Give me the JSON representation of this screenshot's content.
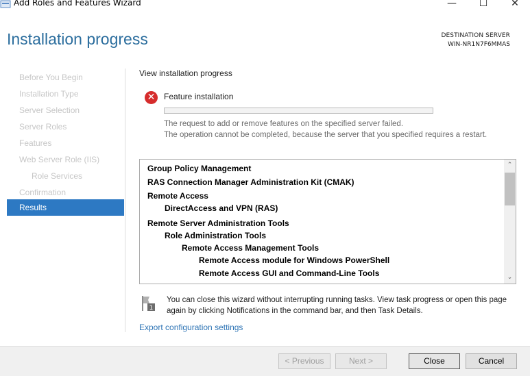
{
  "window": {
    "title": "Add Roles and Features Wizard",
    "minimize": "—",
    "maximize": "☐",
    "close": "✕"
  },
  "header": {
    "page_title": "Installation progress",
    "destination_label": "DESTINATION SERVER",
    "destination_server": "WIN-NR1N7F6MMAS"
  },
  "nav": {
    "items": [
      {
        "label": "Before You Begin"
      },
      {
        "label": "Installation Type"
      },
      {
        "label": "Server Selection"
      },
      {
        "label": "Server Roles"
      },
      {
        "label": "Features"
      },
      {
        "label": "Web Server Role (IIS)"
      },
      {
        "label": "Role Services"
      },
      {
        "label": "Confirmation"
      },
      {
        "label": "Results"
      }
    ],
    "active": "Results"
  },
  "content": {
    "section_label": "View installation progress",
    "status_title": "Feature installation",
    "progress_fraction": 0,
    "error_line1": "The request to add or remove features on the specified server failed.",
    "error_line2": "The operation cannot be completed, because the server that you specified requires a restart.",
    "results": [
      {
        "text": "Group Policy Management",
        "level": 0
      },
      {
        "text": "RAS Connection Manager Administration Kit (CMAK)",
        "level": 0
      },
      {
        "text": "Remote Access",
        "level": 0
      },
      {
        "text": "DirectAccess and VPN (RAS)",
        "level": 1
      },
      {
        "text": "Remote Server Administration Tools",
        "level": 0
      },
      {
        "text": "Role Administration Tools",
        "level": 1
      },
      {
        "text": "Remote Access Management Tools",
        "level": 2
      },
      {
        "text": "Remote Access module for Windows PowerShell",
        "level": 3
      },
      {
        "text": "Remote Access GUI and Command-Line Tools",
        "level": 3
      }
    ],
    "scroll_up": "⌃",
    "scroll_down": "⌄",
    "notice": "You can close this wizard without interrupting running tasks. View task progress or open this page again by clicking Notifications in the command bar, and then Task Details.",
    "flag_badge": "1",
    "export_link": "Export configuration settings"
  },
  "footer": {
    "previous": "< Previous",
    "next": "Next >",
    "close": "Close",
    "cancel": "Cancel"
  },
  "icons": {
    "error": "error-icon",
    "flag": "notification-flag-icon"
  },
  "colors": {
    "title_blue": "#2c6e9e",
    "active_nav": "#2d79c3",
    "error_red": "#d62c2c",
    "link_blue": "#2e74b5"
  }
}
